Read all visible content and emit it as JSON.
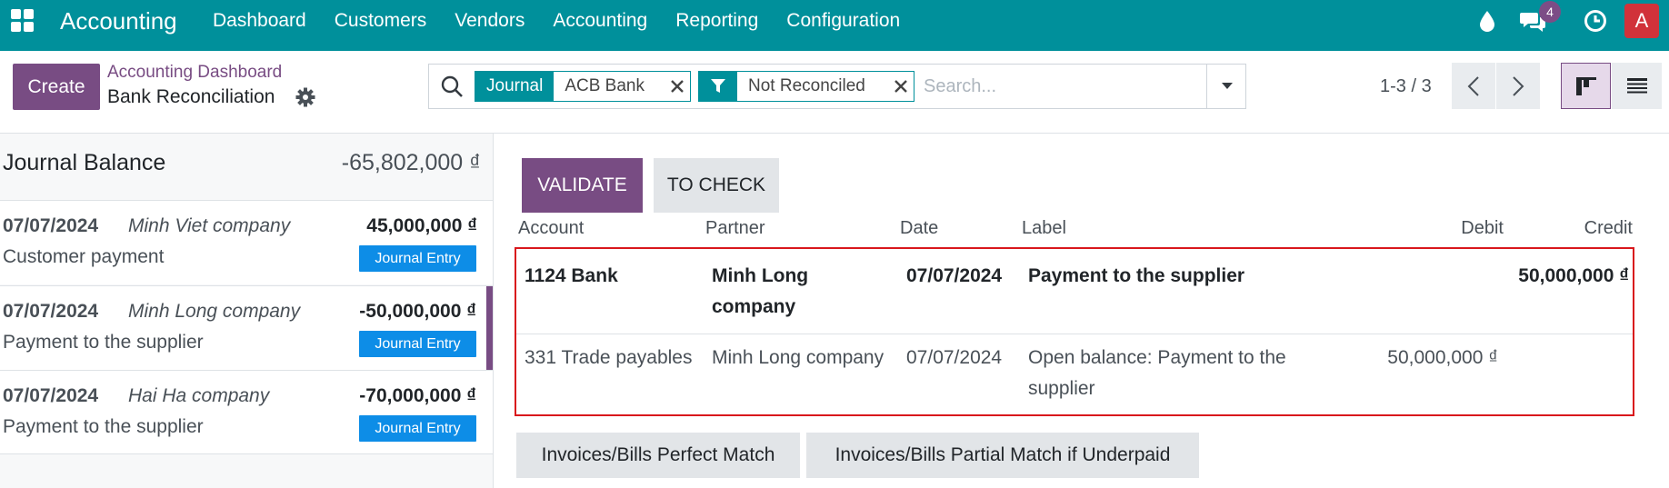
{
  "navbar": {
    "app_title": "Accounting",
    "menu": [
      "Dashboard",
      "Customers",
      "Vendors",
      "Accounting",
      "Reporting",
      "Configuration"
    ],
    "chat_badge": "4",
    "avatar_letter": "A",
    "color": "#00909b"
  },
  "control": {
    "create_label": "Create",
    "breadcrumb_parent": "Accounting Dashboard",
    "breadcrumb_current": "Bank Reconciliation",
    "search": {
      "facets": [
        {
          "label": "Journal",
          "value": "ACB Bank"
        },
        {
          "label_icon": "filter-icon",
          "value": "Not Reconciled"
        }
      ],
      "placeholder": "Search..."
    },
    "pager": "1-3 / 3"
  },
  "left": {
    "journal_balance_label": "Journal Balance",
    "journal_balance_value": "-65,802,000 ₫",
    "lines": [
      {
        "date": "07/07/2024",
        "partner": "Minh Viet company",
        "amount": "45,000,000 ₫",
        "ref": "Customer payment",
        "badge": "Journal Entry"
      },
      {
        "date": "07/07/2024",
        "partner": "Minh Long company",
        "amount": "-50,000,000 ₫",
        "ref": "Payment to the supplier",
        "badge": "Journal Entry",
        "selected": true
      },
      {
        "date": "07/07/2024",
        "partner": "Hai Ha company",
        "amount": "-70,000,000 ₫",
        "ref": "Payment to the supplier",
        "badge": "Journal Entry"
      }
    ]
  },
  "right": {
    "validate_label": "VALIDATE",
    "to_check_label": "TO CHECK",
    "columns": {
      "account": "Account",
      "partner": "Partner",
      "date": "Date",
      "label": "Label",
      "debit": "Debit",
      "credit": "Credit"
    },
    "entries": [
      {
        "account": "1124 Bank",
        "partner": "Minh Long company",
        "date": "07/07/2024",
        "label": "Payment to the supplier",
        "debit": "",
        "credit": "50,000,000 ₫"
      },
      {
        "account": "331 Trade payables",
        "partner": "Minh Long company",
        "date": "07/07/2024",
        "label": "Open balance: Payment to the supplier",
        "debit": "50,000,000 ₫",
        "credit": ""
      }
    ],
    "models": [
      "Invoices/Bills Perfect Match",
      "Invoices/Bills Partial Match if Underpaid"
    ]
  }
}
